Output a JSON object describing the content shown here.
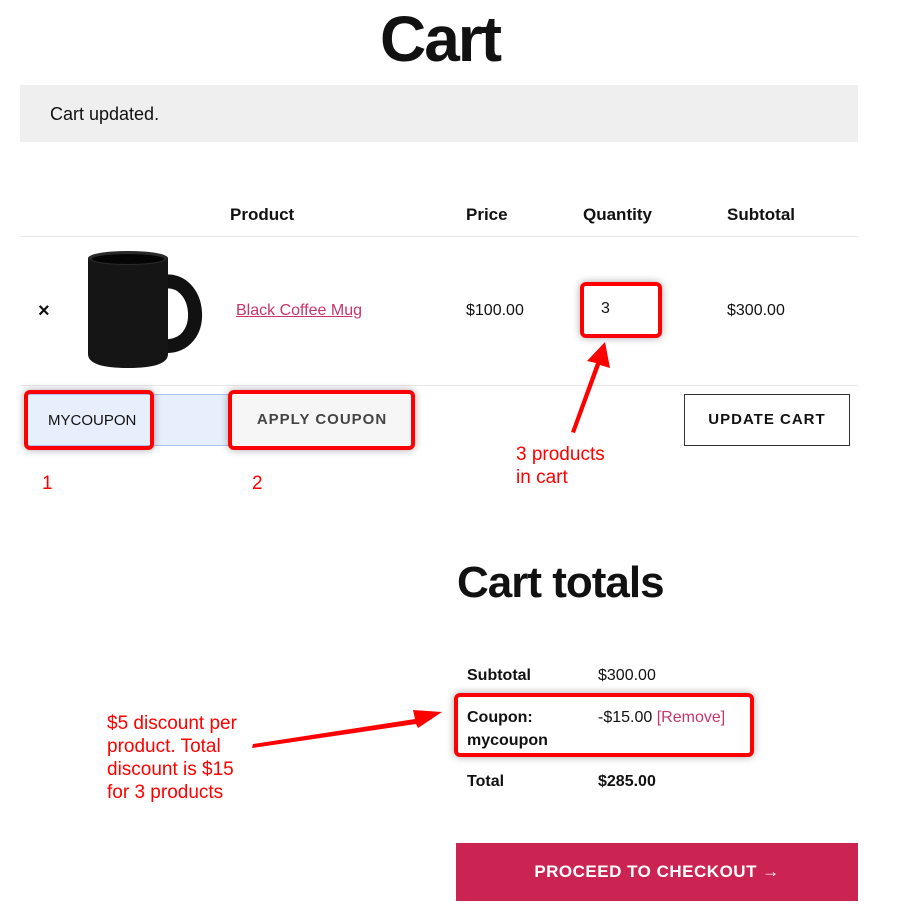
{
  "page_title": "Cart",
  "notice": "Cart updated.",
  "table": {
    "headers": [
      "Product",
      "Price",
      "Quantity",
      "Subtotal"
    ],
    "rows": [
      {
        "remove": "×",
        "product": "Black Coffee Mug",
        "price": "$100.00",
        "quantity": "3",
        "subtotal": "$300.00"
      }
    ]
  },
  "coupon": {
    "value": "MYCOUPON",
    "apply_label": "APPLY COUPON"
  },
  "update_label": "UPDATE CART",
  "totals": {
    "title": "Cart totals",
    "subtotal_label": "Subtotal",
    "subtotal": "$300.00",
    "coupon_label": "Coupon:",
    "coupon_code": "mycoupon",
    "coupon_amount": "-$15.00",
    "remove_label": "[Remove]",
    "total_label": "Total",
    "total": "$285.00"
  },
  "checkout_label": "PROCEED TO CHECKOUT →",
  "annotations": {
    "step1": "1",
    "step2": "2",
    "qty_note": [
      "3 products",
      "in cart"
    ],
    "discount_note": [
      "$5 discount per",
      "product. Total",
      "discount is $15",
      "for 3 products"
    ]
  },
  "colors": {
    "accent": "#cc2452",
    "link": "#c9356a",
    "annotation": "#ff0000"
  }
}
